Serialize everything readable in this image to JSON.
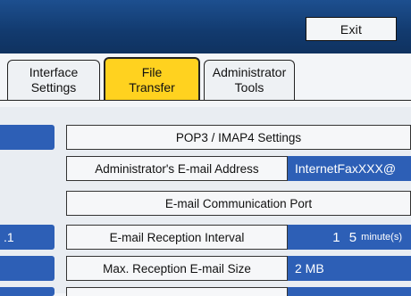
{
  "header": {
    "exit_label": "Exit"
  },
  "tabs": [
    {
      "line1": "Interface",
      "line2": "Settings",
      "active": false
    },
    {
      "line1": "File",
      "line2": "Transfer",
      "active": true
    },
    {
      "line1": "Administrator",
      "line2": "Tools",
      "active": false
    }
  ],
  "left_values": {
    "row4": ".1"
  },
  "settings": [
    {
      "label": "POP3 / IMAP4 Settings",
      "value": ""
    },
    {
      "label": "Administrator's E-mail Address",
      "value": "InternetFaxXXX@"
    },
    {
      "label": "E-mail Communication Port",
      "value": ""
    },
    {
      "label": "E-mail Reception Interval",
      "value": "1 5",
      "unit": "minute(s)"
    },
    {
      "label": "Max. Reception E-mail Size",
      "value": "2 MB"
    }
  ],
  "colors": {
    "header_blue": "#123a6e",
    "active_tab": "#ffd21f",
    "value_blue": "#2d5fb6"
  }
}
